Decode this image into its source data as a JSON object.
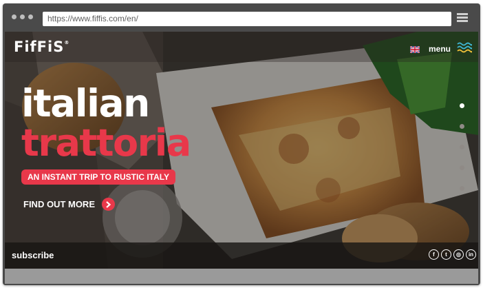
{
  "browser": {
    "url": "https://www.fiffis.com/en/",
    "icons": [
      "window-dot-icon",
      "hamburger-icon"
    ]
  },
  "site": {
    "logo": "FifFiS",
    "logo_mark": "®",
    "language_icon": "uk-flag-icon",
    "menu_label": "menu",
    "menu_icon": "waves-menu-icon"
  },
  "hero": {
    "title_line1": "italian",
    "title_line2": "trattoria",
    "tagline": "AN INSTANT TRIP TO RUSTIC ITALY",
    "cta_label": "FIND OUT MORE",
    "cta_icon": "chevron-right-icon",
    "slides_total": 5,
    "active_slide": 1
  },
  "footer": {
    "subscribe_label": "subscribe",
    "social": [
      {
        "name": "facebook-icon",
        "glyph": "f"
      },
      {
        "name": "twitter-icon",
        "glyph": "t"
      },
      {
        "name": "instagram-icon",
        "glyph": "◎"
      },
      {
        "name": "linkedin-icon",
        "glyph": "in"
      }
    ]
  },
  "colors": {
    "accent": "#e8384a",
    "frame": "#4a4a4a",
    "text_light": "#ffffff"
  }
}
